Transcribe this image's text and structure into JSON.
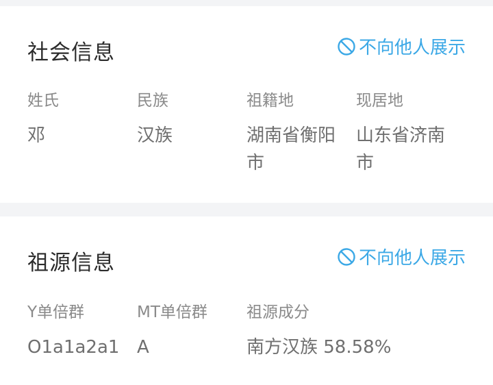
{
  "social": {
    "title": "社会信息",
    "privacy_label": "不向他人展示",
    "fields": [
      {
        "label": "姓氏",
        "value": "邓"
      },
      {
        "label": "民族",
        "value": "汉族"
      },
      {
        "label": "祖籍地",
        "value": "湖南省衡阳市"
      },
      {
        "label": "现居地",
        "value": "山东省济南市"
      }
    ]
  },
  "ancestry": {
    "title": "祖源信息",
    "privacy_label": "不向他人展示",
    "fields": [
      {
        "label": "Y单倍群",
        "value": "O1a1a2a1"
      },
      {
        "label": "MT单倍群",
        "value": "A"
      },
      {
        "label": "祖源成分",
        "value": "南方汉族 58.58%"
      }
    ]
  },
  "colors": {
    "accent": "#3ba8e6",
    "title": "#2b2b2b",
    "label": "#8a8a8a",
    "value": "#6f6f6f",
    "background": "#f3f4f6"
  },
  "icons": {
    "privacy": "prohibited-icon"
  }
}
